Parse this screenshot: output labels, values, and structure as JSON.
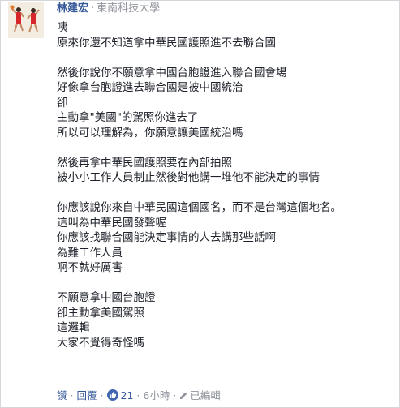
{
  "comment": {
    "author": {
      "name": "林建宏",
      "separator": "·",
      "school": "東南科技大學"
    },
    "lines": [
      "咦",
      "原來你還不知道拿中華民國護照進不去聯合國",
      "",
      "然後你說你不願意拿中國台胞證進入聯合國會場",
      "好像拿台胞證進去聯合國是被中國統治",
      "卻",
      "主動拿\"美國\"的駕照你進去了",
      "所以可以理解為，你願意讓美國統治嗎",
      "",
      "然後再拿中華民國護照要在內部拍照",
      "被小小工作人員制止然後對他講一堆他不能決定的事情",
      "",
      "你應該說你來自中華民國這個國名，而不是台灣這個地名。",
      "這叫為中華民國發聲喔",
      "你應該找聯合國能決定事情的人去講那些話啊",
      "為難工作人員",
      "啊不就好厲害",
      "",
      "不願意拿中國台胞證",
      "卻主動拿美國駕照",
      "這邏輯",
      "大家不覺得奇怪嗎"
    ],
    "actions": {
      "like": "讚",
      "reply": "回覆",
      "like_count": "21",
      "time": "6小時",
      "edited": "已編輯"
    }
  }
}
